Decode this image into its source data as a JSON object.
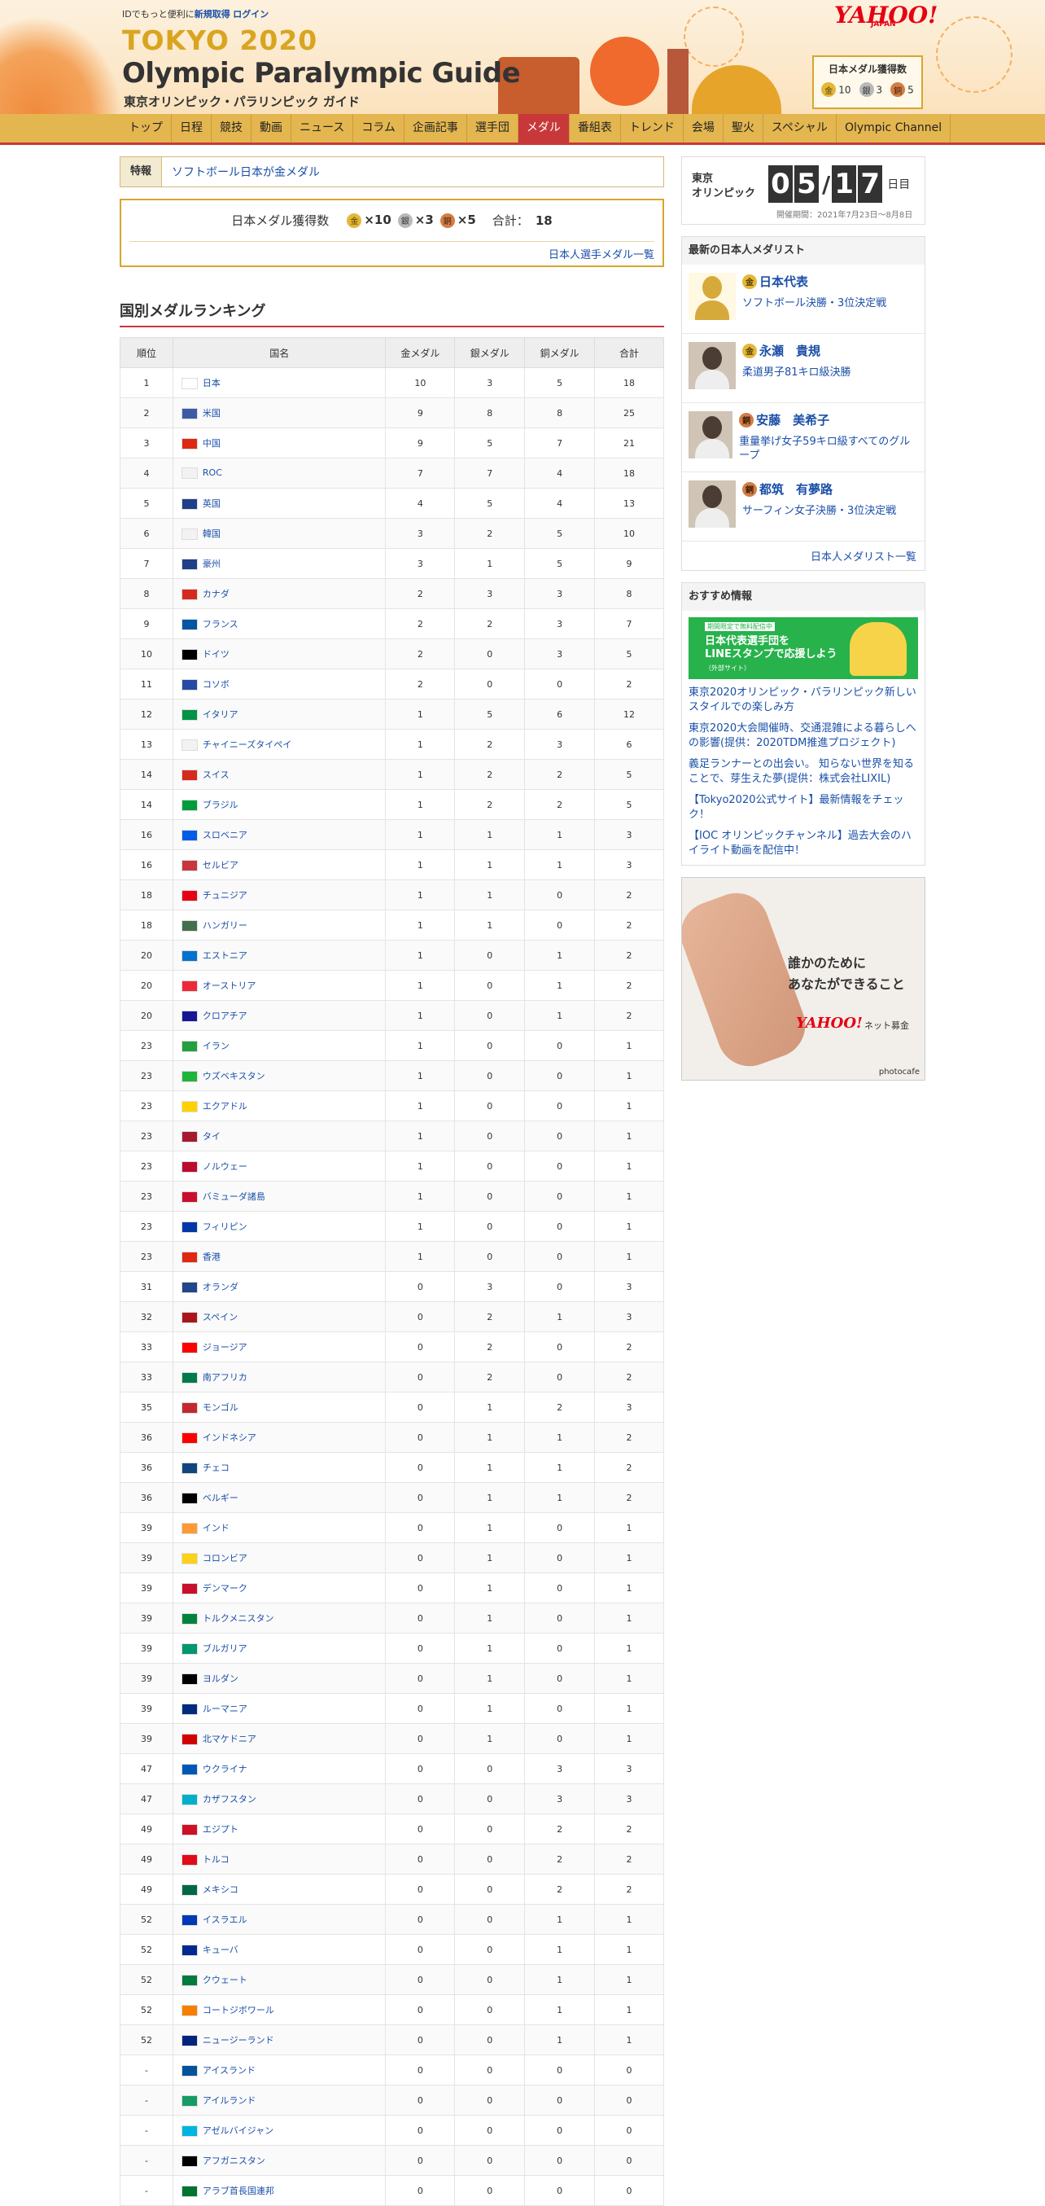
{
  "header": {
    "id_prefix": "IDでもっと便利に",
    "signup": "新規取得",
    "login": "ログイン",
    "logo_title": "TOKYO 2020",
    "logo_sub": "Olympic Paralympic Guide",
    "logo_jp": "東京オリンピック・パラリンピック ガイド",
    "yahoo": "YAHOO!",
    "yahoo_sub": "JAPAN",
    "medal_box_title": "日本メダル獲得数",
    "medal_box": {
      "gold": "10",
      "silver": "3",
      "bronze": "5",
      "gold_icon": "金",
      "silver_icon": "銀",
      "bronze_icon": "銅"
    }
  },
  "nav": [
    "トップ",
    "日程",
    "競技",
    "動画",
    "ニュース",
    "コラム",
    "企画記事",
    "選手団",
    "メダル",
    "番組表",
    "トレンド",
    "会場",
    "聖火",
    "スペシャル",
    "Olympic Channel"
  ],
  "feature": {
    "label": "特報",
    "text": "ソフトボール日本が金メダル"
  },
  "summary": {
    "label": "日本メダル獲得数",
    "gold": "×10",
    "silver": "×3",
    "bronze": "×5",
    "total_label": "合計：",
    "total": "18",
    "more": "日本人選手メダル一覧"
  },
  "ranking": {
    "title": "国別メダルランキング",
    "headers": [
      "順位",
      "国名",
      "金メダル",
      "銀メダル",
      "銅メダル",
      "合計"
    ],
    "rows": [
      [
        "1",
        "日本",
        "10",
        "3",
        "5",
        "18"
      ],
      [
        "2",
        "米国",
        "9",
        "8",
        "8",
        "25"
      ],
      [
        "3",
        "中国",
        "9",
        "5",
        "7",
        "21"
      ],
      [
        "4",
        "ROC",
        "7",
        "7",
        "4",
        "18"
      ],
      [
        "5",
        "英国",
        "4",
        "5",
        "4",
        "13"
      ],
      [
        "6",
        "韓国",
        "3",
        "2",
        "5",
        "10"
      ],
      [
        "7",
        "豪州",
        "3",
        "1",
        "5",
        "9"
      ],
      [
        "8",
        "カナダ",
        "2",
        "3",
        "3",
        "8"
      ],
      [
        "9",
        "フランス",
        "2",
        "2",
        "3",
        "7"
      ],
      [
        "10",
        "ドイツ",
        "2",
        "0",
        "3",
        "5"
      ],
      [
        "11",
        "コソボ",
        "2",
        "0",
        "0",
        "2"
      ],
      [
        "12",
        "イタリア",
        "1",
        "5",
        "6",
        "12"
      ],
      [
        "13",
        "チャイニーズタイペイ",
        "1",
        "2",
        "3",
        "6"
      ],
      [
        "14",
        "スイス",
        "1",
        "2",
        "2",
        "5"
      ],
      [
        "14",
        "ブラジル",
        "1",
        "2",
        "2",
        "5"
      ],
      [
        "16",
        "スロベニア",
        "1",
        "1",
        "1",
        "3"
      ],
      [
        "16",
        "セルビア",
        "1",
        "1",
        "1",
        "3"
      ],
      [
        "18",
        "チュニジア",
        "1",
        "1",
        "0",
        "2"
      ],
      [
        "18",
        "ハンガリー",
        "1",
        "1",
        "0",
        "2"
      ],
      [
        "20",
        "エストニア",
        "1",
        "0",
        "1",
        "2"
      ],
      [
        "20",
        "オーストリア",
        "1",
        "0",
        "1",
        "2"
      ],
      [
        "20",
        "クロアチア",
        "1",
        "0",
        "1",
        "2"
      ],
      [
        "23",
        "イラン",
        "1",
        "0",
        "0",
        "1"
      ],
      [
        "23",
        "ウズベキスタン",
        "1",
        "0",
        "0",
        "1"
      ],
      [
        "23",
        "エクアドル",
        "1",
        "0",
        "0",
        "1"
      ],
      [
        "23",
        "タイ",
        "1",
        "0",
        "0",
        "1"
      ],
      [
        "23",
        "ノルウェー",
        "1",
        "0",
        "0",
        "1"
      ],
      [
        "23",
        "バミューダ諸島",
        "1",
        "0",
        "0",
        "1"
      ],
      [
        "23",
        "フィリピン",
        "1",
        "0",
        "0",
        "1"
      ],
      [
        "23",
        "香港",
        "1",
        "0",
        "0",
        "1"
      ],
      [
        "31",
        "オランダ",
        "0",
        "3",
        "0",
        "3"
      ],
      [
        "32",
        "スペイン",
        "0",
        "2",
        "1",
        "3"
      ],
      [
        "33",
        "ジョージア",
        "0",
        "2",
        "0",
        "2"
      ],
      [
        "33",
        "南アフリカ",
        "0",
        "2",
        "0",
        "2"
      ],
      [
        "35",
        "モンゴル",
        "0",
        "1",
        "2",
        "3"
      ],
      [
        "36",
        "インドネシア",
        "0",
        "1",
        "1",
        "2"
      ],
      [
        "36",
        "チェコ",
        "0",
        "1",
        "1",
        "2"
      ],
      [
        "36",
        "ベルギー",
        "0",
        "1",
        "1",
        "2"
      ],
      [
        "39",
        "インド",
        "0",
        "1",
        "0",
        "1"
      ],
      [
        "39",
        "コロンビア",
        "0",
        "1",
        "0",
        "1"
      ],
      [
        "39",
        "デンマーク",
        "0",
        "1",
        "0",
        "1"
      ],
      [
        "39",
        "トルクメニスタン",
        "0",
        "1",
        "0",
        "1"
      ],
      [
        "39",
        "ブルガリア",
        "0",
        "1",
        "0",
        "1"
      ],
      [
        "39",
        "ヨルダン",
        "0",
        "1",
        "0",
        "1"
      ],
      [
        "39",
        "ルーマニア",
        "0",
        "1",
        "0",
        "1"
      ],
      [
        "39",
        "北マケドニア",
        "0",
        "1",
        "0",
        "1"
      ],
      [
        "47",
        "ウクライナ",
        "0",
        "0",
        "3",
        "3"
      ],
      [
        "47",
        "カザフスタン",
        "0",
        "0",
        "3",
        "3"
      ],
      [
        "49",
        "エジプト",
        "0",
        "0",
        "2",
        "2"
      ],
      [
        "49",
        "トルコ",
        "0",
        "0",
        "2",
        "2"
      ],
      [
        "49",
        "メキシコ",
        "0",
        "0",
        "2",
        "2"
      ],
      [
        "52",
        "イスラエル",
        "0",
        "0",
        "1",
        "1"
      ],
      [
        "52",
        "キューバ",
        "0",
        "0",
        "1",
        "1"
      ],
      [
        "52",
        "クウェート",
        "0",
        "0",
        "1",
        "1"
      ],
      [
        "52",
        "コートジボワール",
        "0",
        "0",
        "1",
        "1"
      ],
      [
        "52",
        "ニュージーランド",
        "0",
        "0",
        "1",
        "1"
      ],
      [
        "-",
        "アイスランド",
        "0",
        "0",
        "0",
        "0"
      ],
      [
        "-",
        "アイルランド",
        "0",
        "0",
        "0",
        "0"
      ],
      [
        "-",
        "アゼルバイジャン",
        "0",
        "0",
        "0",
        "0"
      ],
      [
        "-",
        "アフガニスタン",
        "0",
        "0",
        "0",
        "0"
      ],
      [
        "-",
        "アラブ首長国連邦",
        "0",
        "0",
        "0",
        "0"
      ]
    ],
    "flag_colors": [
      "#ffffff",
      "#3c5aa6",
      "#de2910",
      "#f2f2f2",
      "#1f3f8a",
      "#f2f2f2",
      "#1f3f8a",
      "#d52b1e",
      "#0055a4",
      "#000000",
      "#244aa5",
      "#009246",
      "#f2f2f2",
      "#d52b1e",
      "#009c3b",
      "#005ce5",
      "#c6363c",
      "#e70013",
      "#436f4d",
      "#0072ce",
      "#ed2939",
      "#171796",
      "#239f40",
      "#1eb53a",
      "#ffd100",
      "#a51931",
      "#ba0c2f",
      "#c8102e",
      "#0038a8",
      "#de2910",
      "#21468b",
      "#aa151b",
      "#ff0000",
      "#007a4d",
      "#c4272f",
      "#ff0000",
      "#11457e",
      "#000000",
      "#ff9933",
      "#fcd116",
      "#c8102e",
      "#00843d",
      "#00966e",
      "#000000",
      "#002b7f",
      "#d20000",
      "#0057b7",
      "#00afca",
      "#ce1126",
      "#e30a17",
      "#006847",
      "#0038b8",
      "#002a8f",
      "#007a3d",
      "#f77f00",
      "#00247d",
      "#02529c",
      "#169b62",
      "#00b5e2",
      "#000000",
      "#00732f"
    ]
  },
  "sidebar": {
    "timer": {
      "label_line1": "東京",
      "label_line2": "オリンピック",
      "d1": "0",
      "d2": "5",
      "slash": "/",
      "d3": "1",
      "d4": "7",
      "day": "日目",
      "period": "開催期間：2021年7月23日〜8月8日"
    },
    "medalists": {
      "title": "最新の日本人メダリスト",
      "items": [
        {
          "medal": "金",
          "name": "日本代表",
          "event": "ソフトボール決勝・3位決定戦"
        },
        {
          "medal": "金",
          "name": "永瀬　貴規",
          "event": "柔道男子81キロ級決勝"
        },
        {
          "medal": "銅",
          "name": "安藤　美希子",
          "event": "重量挙げ女子59キロ級すべてのグループ"
        },
        {
          "medal": "銅",
          "name": "都筑　有夢路",
          "event": "サーフィン女子決勝・3位決定戦"
        }
      ],
      "more": "日本人メダリスト一覧"
    },
    "recommend": {
      "title": "おすすめ情報",
      "banner_small": "期間限定で無料配信中",
      "banner_line1": "日本代表選手団を",
      "banner_line2": "LINEスタンプで応援しよう",
      "banner_line3": "（外部サイト）",
      "links": [
        "東京2020オリンピック・パラリンピック新しいスタイルでの楽しみ方",
        "東京2020大会開催時、交通混雑による暮らしへの影響(提供：2020TDM推進プロジェクト)",
        "義足ランナーとの出会い。 知らない世界を知ることで、芽生えた夢(提供：株式会社LIXIL)",
        "【Tokyo2020公式サイト】最新情報をチェック！",
        "【IOC オリンピックチャンネル】過去大会のハイライト動画を配信中！"
      ]
    },
    "ad": {
      "line1": "誰かのために",
      "line2": "あなたができること",
      "brand": "YAHOO!",
      "brand_sub": "JAPAN",
      "service": "ネット募金",
      "credit": "photocafe"
    }
  }
}
